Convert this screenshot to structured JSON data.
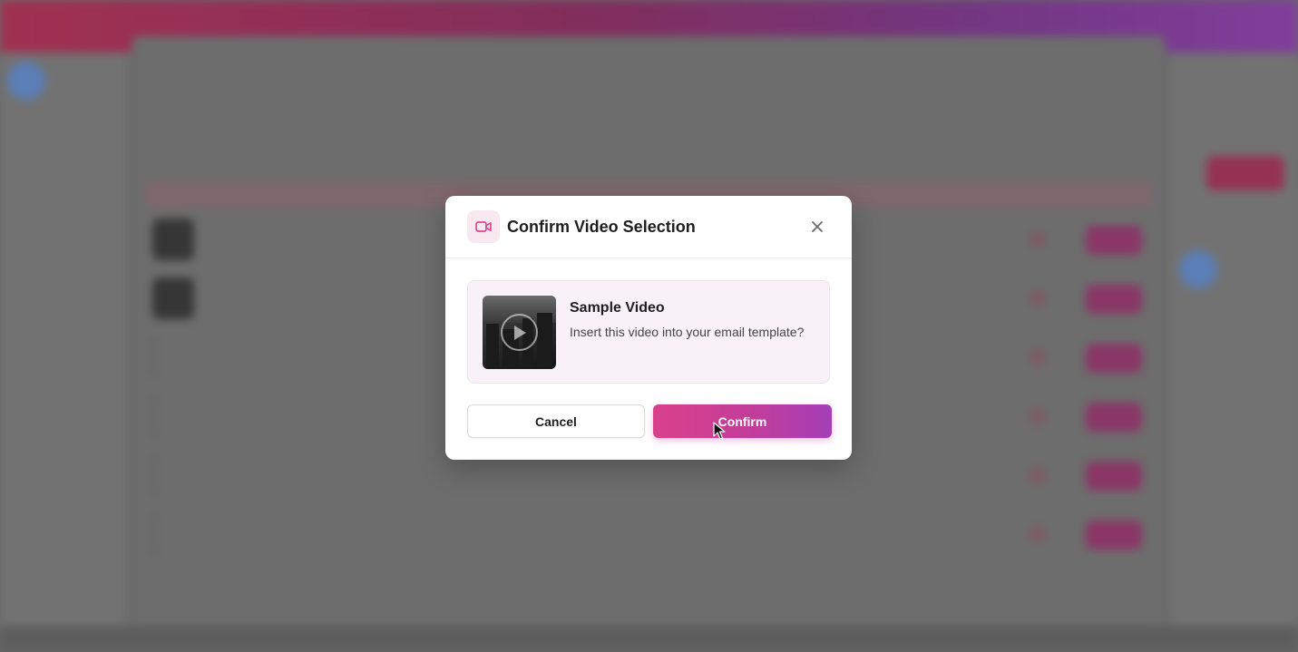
{
  "modal": {
    "title": "Confirm Video Selection",
    "header_icon": "video-camera-icon",
    "close_icon": "close-icon",
    "video": {
      "title": "Sample Video",
      "description": "Insert this video into your email template?",
      "thumbnail_icon": "play-icon"
    },
    "cancel_label": "Cancel",
    "confirm_label": "Confirm"
  },
  "colors": {
    "accent_pink": "#d9418a",
    "accent_purple": "#a53fb8",
    "card_background": "#f8f2f8",
    "icon_background": "#f8e9f1"
  }
}
